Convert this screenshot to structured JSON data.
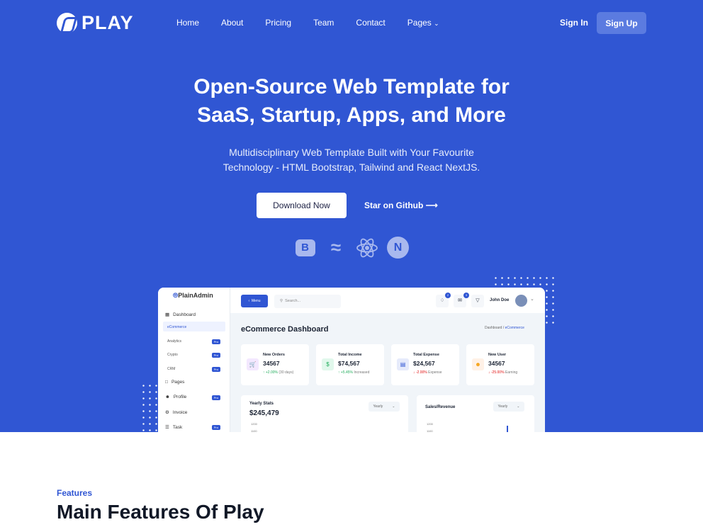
{
  "brand": {
    "name": "PLAY",
    "accent": "#3056D3"
  },
  "nav": {
    "items": [
      "Home",
      "About",
      "Pricing",
      "Team",
      "Contact",
      "Pages"
    ],
    "sign_in": "Sign In",
    "sign_up": "Sign Up"
  },
  "hero": {
    "title_line1": "Open-Source Web Template for",
    "title_line2": "SaaS, Startup, Apps, and More",
    "subtitle_line1": "Multidisciplinary Web Template Built with Your Favourite",
    "subtitle_line2": "Technology - HTML Bootstrap, Tailwind and React NextJS.",
    "download": "Download Now",
    "github": "Star on Github",
    "tech_icons": [
      "bootstrap-icon",
      "tailwind-icon",
      "react-icon",
      "nextjs-icon"
    ]
  },
  "dashboard": {
    "logo": "PlainAdmin",
    "menu": "Menu",
    "search_placeholder": "Search...",
    "notif_count": "2",
    "msg_count": "3",
    "user": "John Doe",
    "title": "eCommerce Dashboard",
    "breadcrumb": [
      "Dashboard",
      "/",
      "eCommerce"
    ],
    "sidebar": {
      "dashboard": "Dashboard",
      "subs": [
        "eCommerce",
        "Analytics",
        "Crypto",
        "CRM"
      ],
      "pages": "Pages",
      "profile": "Profile",
      "invoice": "Invoice",
      "task": "Task",
      "pro": "Pro"
    },
    "cards": [
      {
        "label": "New Orders",
        "value": "34567",
        "change": "+2.00%",
        "note": "(30 days)"
      },
      {
        "label": "Total Income",
        "value": "$74,567",
        "change": "+5.45%",
        "note": "Increased"
      },
      {
        "label": "Total Expense",
        "value": "$24,567",
        "change": "-2.00%",
        "note": "Expense"
      },
      {
        "label": "New User",
        "value": "34567",
        "change": "-25.00%",
        "note": "Earning"
      }
    ],
    "yearly": {
      "title": "Yearly Stats",
      "value": "$245,479",
      "select": "Yearly",
      "tick1": "1200",
      "tick2": "1100"
    },
    "sales": {
      "title": "Sales/Revenue",
      "select": "Yearly",
      "tick1": "1200",
      "tick2": "1100"
    }
  },
  "features": {
    "label": "Features",
    "title": "Main Features Of Play"
  }
}
